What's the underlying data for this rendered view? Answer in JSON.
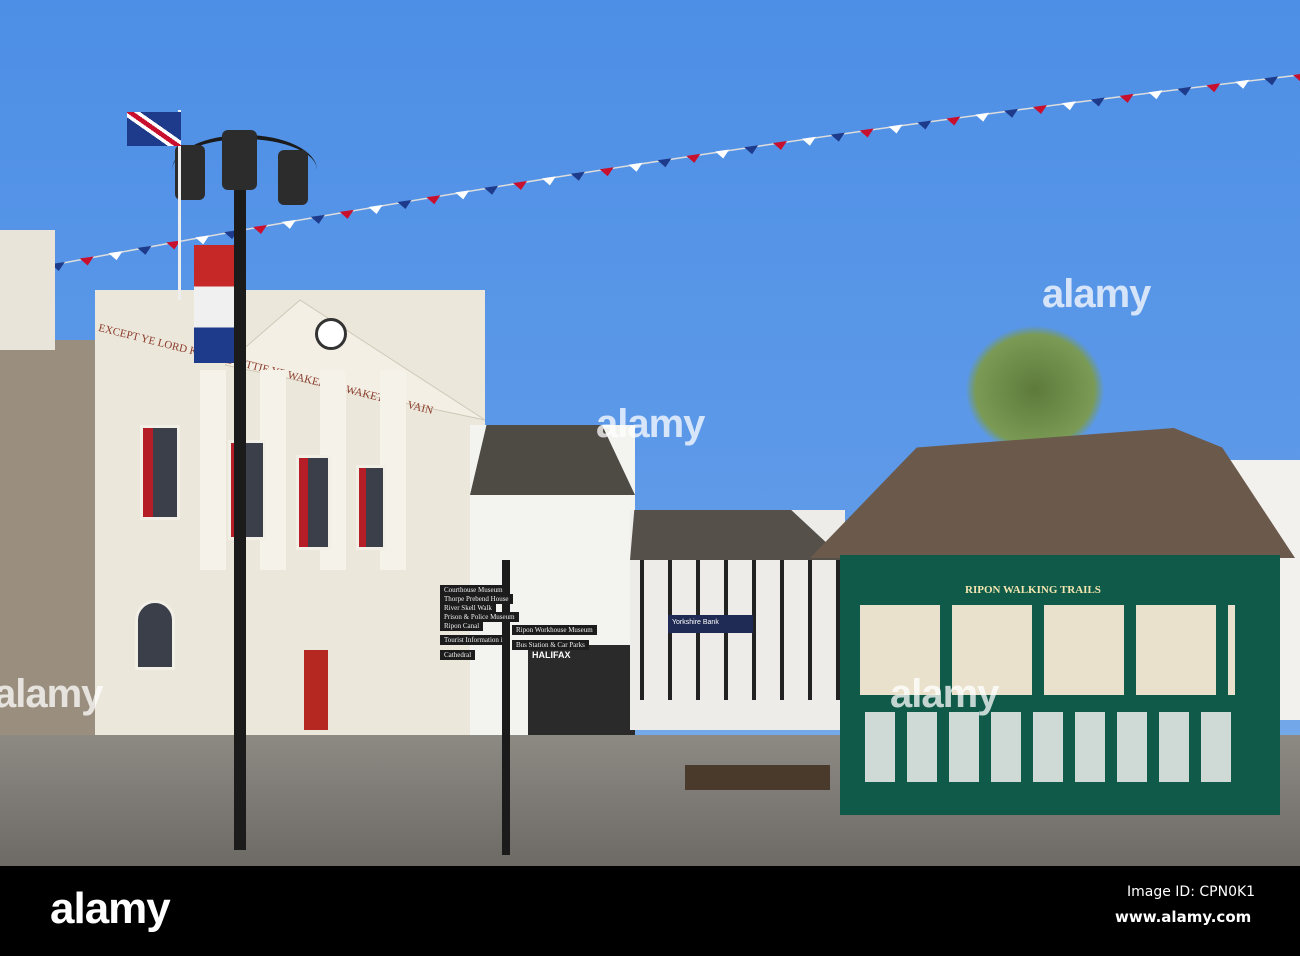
{
  "watermark": "alamy",
  "building": {
    "inscription": "EXCEPT YE LORD KEEP YE CITTIE YE WAKEMAN WAKETH IN VAIN"
  },
  "signpost": {
    "items": [
      "Courthouse Museum",
      "Thorpe Prebend House",
      "River Skell Walk",
      "Prison & Police Museum",
      "Ripon Canal",
      "Tourist Information i",
      "Cathedral",
      "Ripon Workhouse Museum",
      "Bus Station & Car Parks"
    ]
  },
  "shops": {
    "halifax": "HALIFAX",
    "yorkshire_bank": "Yorkshire Bank"
  },
  "shelter": {
    "sign": "RIPON WALKING TRAILS"
  },
  "footer": {
    "logo": "alamy",
    "image_id": "Image ID: CPN0K1",
    "url": "www.alamy.com"
  },
  "colors": {
    "sky": "#4d8fe6",
    "shelter_green": "#0f5a48",
    "footer": "#000000"
  }
}
